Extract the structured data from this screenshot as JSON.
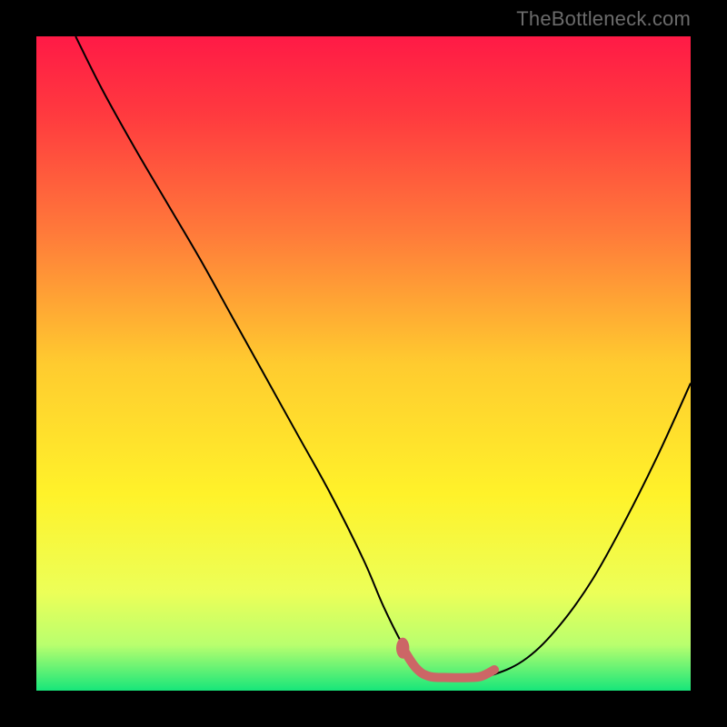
{
  "watermark": "TheBottleneck.com",
  "chart_data": {
    "type": "line",
    "title": "",
    "xlabel": "",
    "ylabel": "",
    "xlim": [
      0,
      100
    ],
    "ylim": [
      0,
      100
    ],
    "grid": false,
    "legend": false,
    "background_gradient": {
      "stops": [
        {
          "offset": 0.0,
          "color": "#ff1a46"
        },
        {
          "offset": 0.12,
          "color": "#ff3a3f"
        },
        {
          "offset": 0.3,
          "color": "#ff7a3a"
        },
        {
          "offset": 0.5,
          "color": "#ffcb2f"
        },
        {
          "offset": 0.7,
          "color": "#fff22a"
        },
        {
          "offset": 0.85,
          "color": "#ecff58"
        },
        {
          "offset": 0.93,
          "color": "#b9ff6e"
        },
        {
          "offset": 1.0,
          "color": "#17e67a"
        }
      ]
    },
    "series": [
      {
        "name": "curve",
        "color": "#000000",
        "stroke_width": 2,
        "x": [
          6,
          10,
          15,
          20,
          25,
          30,
          35,
          40,
          45,
          50,
          53,
          56,
          58,
          60,
          63,
          66,
          70,
          75,
          80,
          85,
          90,
          95,
          100
        ],
        "y": [
          100,
          92,
          83,
          74.5,
          66,
          57,
          48,
          39,
          30,
          20,
          13,
          7,
          4,
          2.5,
          2,
          2,
          2.5,
          5,
          10,
          17,
          26,
          36,
          47
        ]
      },
      {
        "name": "highlight",
        "color": "#cc6666",
        "stroke_width": 10,
        "linecap": "round",
        "x": [
          56,
          58,
          60,
          63,
          66,
          68,
          70
        ],
        "y": [
          6.5,
          3.5,
          2.2,
          2,
          2,
          2.2,
          3.2
        ]
      }
    ],
    "markers": [
      {
        "name": "highlight-start-dot",
        "shape": "ellipse",
        "cx": 56,
        "cy": 6.5,
        "rx": 1.0,
        "ry": 1.6,
        "color": "#cc6666"
      }
    ]
  }
}
